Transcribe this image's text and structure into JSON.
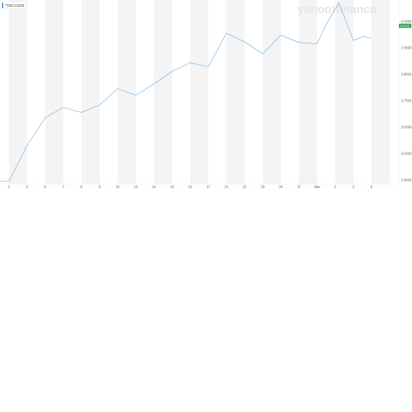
{
  "chart_data": {
    "type": "line",
    "title": "",
    "xlabel": "",
    "ylabel": "",
    "ylim": [
      3.4,
      4.0
    ],
    "y_ticks": [
      "3.4000",
      "3.5000",
      "3.6000",
      "3.7000",
      "3.8000",
      "3.9000",
      "4.0000"
    ],
    "x_ticks": [
      "2",
      "3",
      "6",
      "7",
      "8",
      "9",
      "10",
      "13",
      "14",
      "15",
      "16",
      "17",
      "21",
      "22",
      "23",
      "24",
      "27",
      "Mar",
      "2",
      "3",
      "6"
    ],
    "grid": "alternating vertical bands",
    "legend": {
      "symbol": "^TNX",
      "value": "3.9220",
      "placement": "top-left"
    },
    "last_price_tag": "3.9220",
    "watermark": "yahoo!finance",
    "series": [
      {
        "values": [
          3.395,
          3.395,
          3.53,
          3.635,
          3.675,
          3.655,
          3.683,
          3.745,
          3.72,
          3.763,
          3.81,
          3.843,
          3.828,
          3.955,
          3.922,
          3.877,
          3.947,
          3.92,
          3.915,
          3.988,
          4.07,
          3.928,
          3.943,
          3.935
        ],
        "x_index": [
          -0.5,
          0,
          1,
          2,
          3,
          4,
          5,
          6,
          7,
          8,
          9,
          10,
          11,
          12,
          13,
          14,
          15,
          16,
          17,
          17.5,
          18.2,
          19,
          19.6,
          20
        ]
      }
    ],
    "colors": {
      "line": "#7cb8e8",
      "band": "#f4f4f4",
      "price_tag": "#21a04f",
      "legend_marker": "#1e88e5"
    }
  }
}
